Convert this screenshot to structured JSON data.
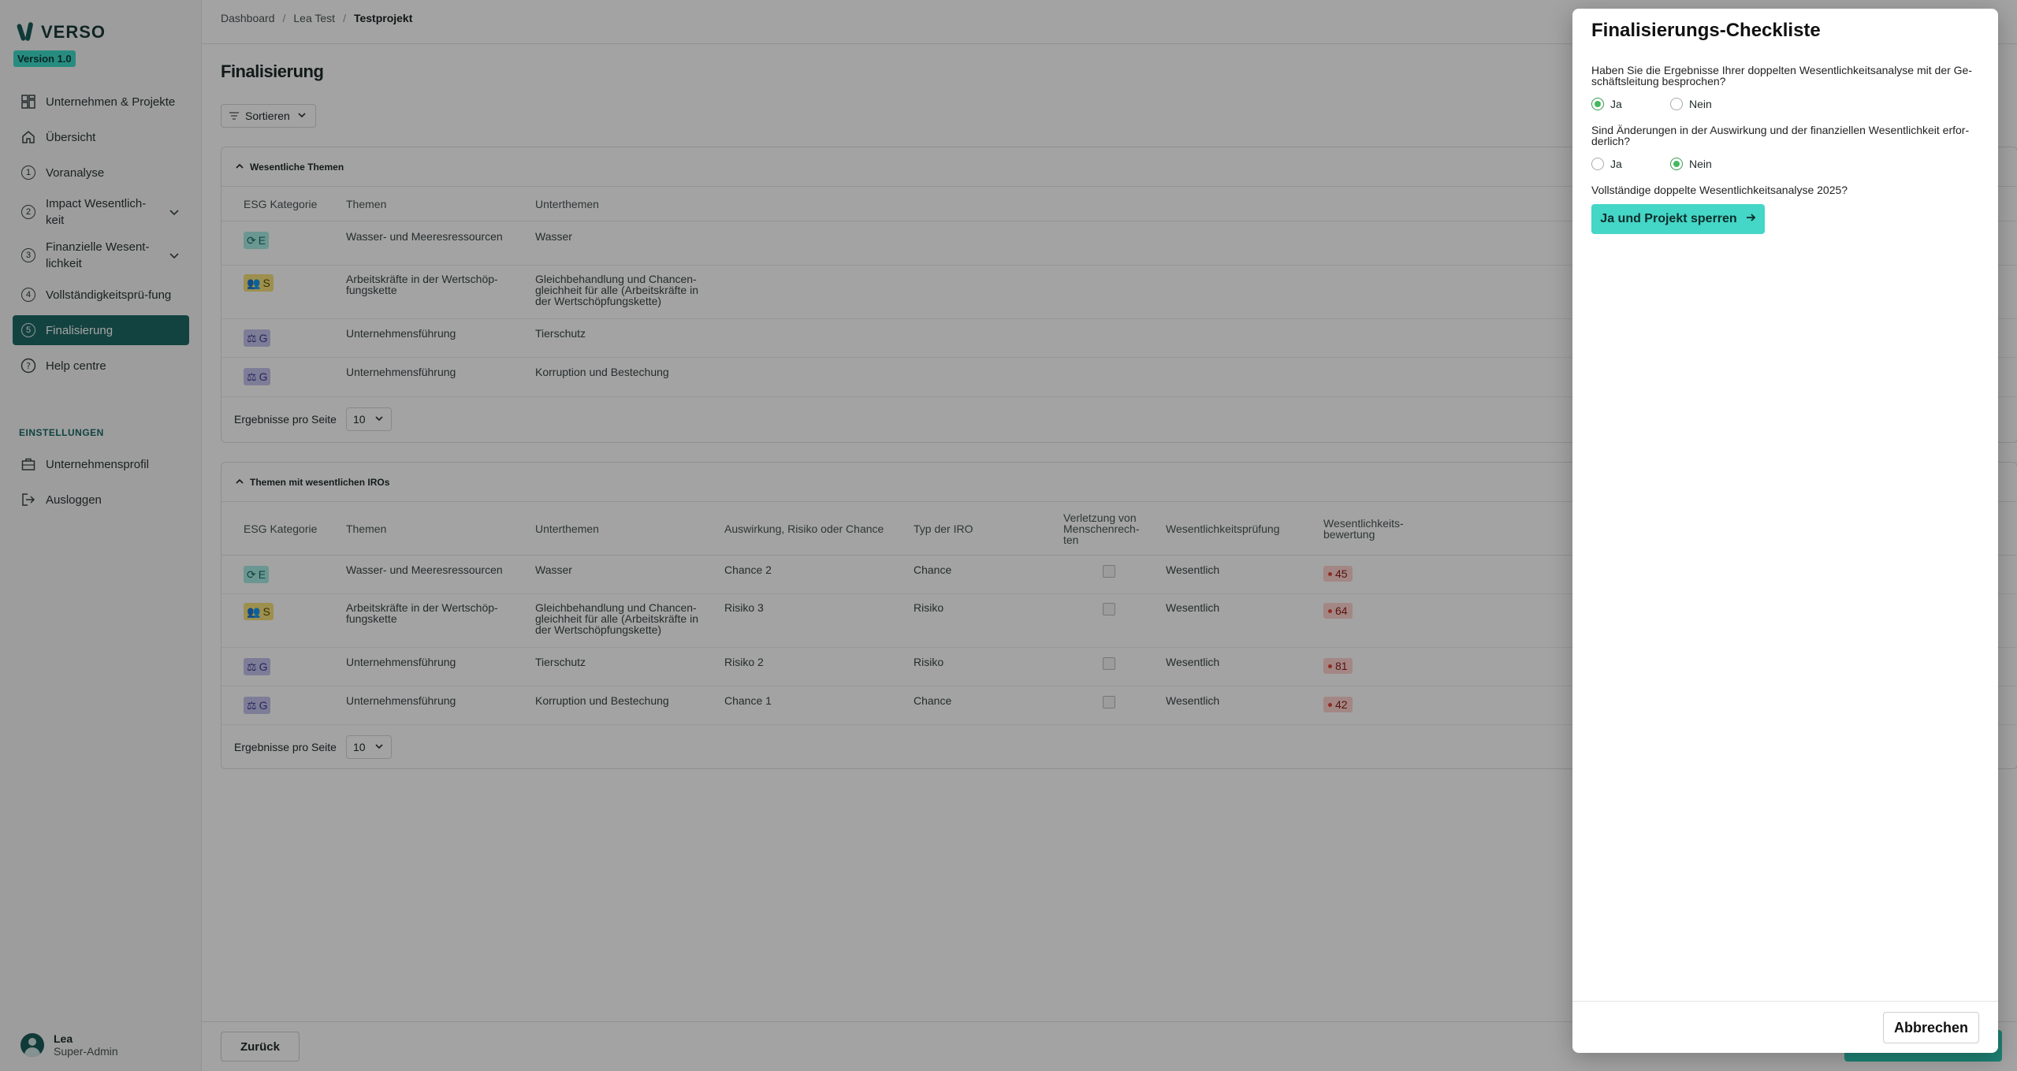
{
  "app": {
    "logo": "VERSO",
    "version": "Version 1.0"
  },
  "sidebar": {
    "items": [
      {
        "label": "Unternehmen & Projekte"
      },
      {
        "label": "Übersicht"
      },
      {
        "label": "Voranalyse",
        "num": "1"
      },
      {
        "label": "Impact Wesentlich-keit",
        "num": "2"
      },
      {
        "label": "Finanzielle Wesent-lichkeit",
        "num": "3"
      },
      {
        "label": "Vollständigkeitsprü-fung",
        "num": "4"
      },
      {
        "label": "Finalisierung",
        "num": "5"
      },
      {
        "label": "Help centre"
      }
    ],
    "settings_label": "EINSTELLUNGEN",
    "settings_items": [
      {
        "label": "Unternehmensprofil"
      },
      {
        "label": "Ausloggen"
      }
    ],
    "user": {
      "name": "Lea",
      "role": "Super-Admin"
    }
  },
  "breadcrumb": [
    "Dashboard",
    "Lea Test",
    "Testprojekt"
  ],
  "page": {
    "title": "Finalisierung",
    "sort_label": "Sortieren",
    "back_label": "Zurück"
  },
  "table1": {
    "title": "Wesentliche Themen",
    "headers": [
      "ESG Kategorie",
      "Themen",
      "Unterthemen"
    ],
    "rows": [
      {
        "cat": "E",
        "themen": "Wasser- und Meeresressourcen",
        "unter": "Wasser"
      },
      {
        "cat": "S",
        "themen": "Arbeitskräfte in der Wertschöp-fungskette",
        "unter": "Gleichbehandlung und Chancen-gleichheit für alle (Arbeitskräfte in der Wertschöpfungskette)"
      },
      {
        "cat": "G",
        "themen": "Unternehmensführung",
        "unter": "Tierschutz"
      },
      {
        "cat": "G",
        "themen": "Unternehmensführung",
        "unter": "Korruption und Bestechung"
      }
    ],
    "per_page_label": "Ergebnisse pro Seite",
    "per_page": "10"
  },
  "table2": {
    "title": "Themen mit wesentlichen IROs",
    "headers": [
      "ESG Kategorie",
      "Themen",
      "Unterthemen",
      "Auswirkung, Risiko oder Chance",
      "Typ der IRO",
      "Verletzung von Menschenrech-ten",
      "Wesentlichkeitsprüfung",
      "Wesentlichkeits-bewertung"
    ],
    "rows": [
      {
        "cat": "E",
        "themen": "Wasser- und Meeresressourcen",
        "unter": "Wasser",
        "iro": "Chance 2",
        "typ": "Chance",
        "pruefung": "Wesentlich",
        "score": "45"
      },
      {
        "cat": "S",
        "themen": "Arbeitskräfte in der Wertschöp-fungskette",
        "unter": "Gleichbehandlung und Chancen-gleichheit für alle (Arbeitskräfte in der Wertschöpfungskette)",
        "iro": "Risiko 3",
        "typ": "Risiko",
        "pruefung": "Wesentlich",
        "score": "64"
      },
      {
        "cat": "G",
        "themen": "Unternehmensführung",
        "unter": "Tierschutz",
        "iro": "Risiko 2",
        "typ": "Risiko",
        "pruefung": "Wesentlich",
        "score": "81"
      },
      {
        "cat": "G",
        "themen": "Unternehmensführung",
        "unter": "Korruption und Bestechung",
        "iro": "Chance 1",
        "typ": "Chance",
        "pruefung": "Wesentlich",
        "score": "42"
      }
    ],
    "per_page_label": "Ergebnisse pro Seite",
    "per_page": "10"
  },
  "modal": {
    "title": "Finalisierungs-Checkliste",
    "q1": "Haben Sie die Ergebnisse Ihrer doppelten Wesentlichkeitsanalyse mit der Ge-schäftsleitung besprochen?",
    "q1_yes": "Ja",
    "q1_no": "Nein",
    "q1_selected": "Ja",
    "q2": "Sind Änderungen in der Auswirkung und der finanziellen Wesentlichkeit erfor-derlich?",
    "q2_yes": "Ja",
    "q2_no": "Nein",
    "q2_selected": "Nein",
    "q3": "Vollständige doppelte Wesentlichkeitsanalyse 2025?",
    "cta_label": "Ja und Projekt sperren",
    "cancel_label": "Abbrechen"
  },
  "colors": {
    "brand": "#1f6a66",
    "accent": "#44d6c7",
    "overlay": "rgba(0,0,0,0.36)"
  }
}
